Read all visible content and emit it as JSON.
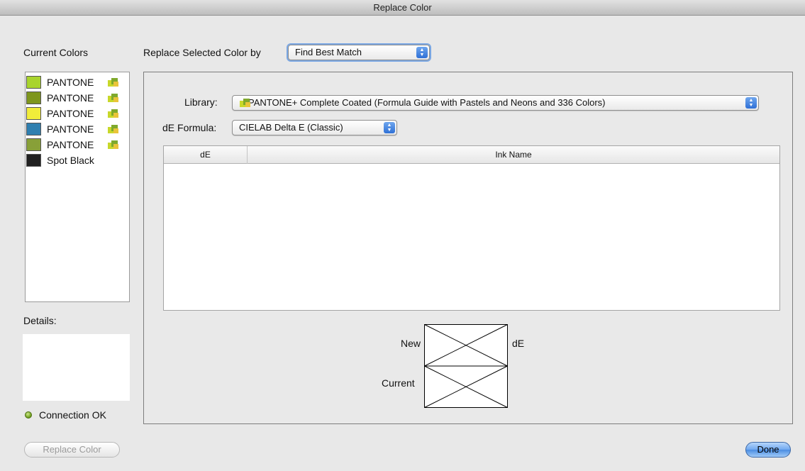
{
  "window": {
    "title": "Replace Color"
  },
  "left": {
    "current_colors_label": "Current Colors",
    "colors": [
      {
        "name": "PANTONE",
        "color": "#a9d42d",
        "library_icon": true
      },
      {
        "name": "PANTONE",
        "color": "#7e961d",
        "library_icon": true
      },
      {
        "name": "PANTONE",
        "color": "#f1ec3a",
        "library_icon": true
      },
      {
        "name": "PANTONE",
        "color": "#2f7fb0",
        "library_icon": true
      },
      {
        "name": "PANTONE",
        "color": "#88a038",
        "library_icon": true
      },
      {
        "name": "Spot Black",
        "color": "#202020",
        "library_icon": false
      }
    ],
    "details_label": "Details:",
    "connection_status": "Connection OK",
    "replace_button": "Replace Color"
  },
  "header": {
    "replace_by_label": "Replace Selected Color by",
    "replace_by_value": "Find Best Match"
  },
  "panel": {
    "library_label": "Library:",
    "library_value": "PANTONE+ Complete Coated (Formula Guide with Pastels and Neons and 336 Colors)",
    "formula_label": "dE Formula:",
    "formula_value": "CIELAB Delta E (Classic)",
    "table": {
      "columns": [
        "dE",
        "Ink Name"
      ],
      "rows": []
    },
    "compare": {
      "new_label": "New",
      "current_label": "Current",
      "de_label": "dE"
    }
  },
  "footer": {
    "done_button": "Done"
  }
}
